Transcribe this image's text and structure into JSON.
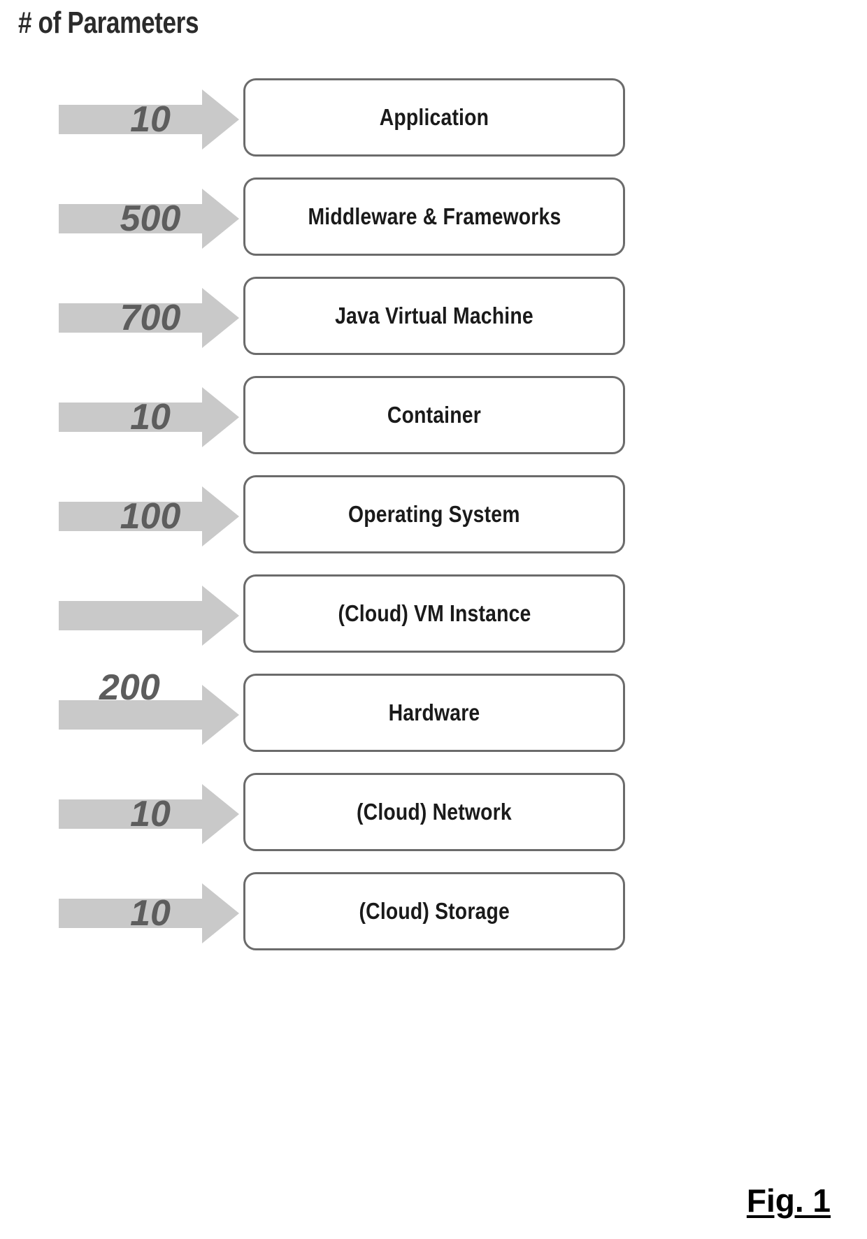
{
  "figure": {
    "title": "# of Parameters",
    "caption": "Fig. 1",
    "arrow_color": "#c9c9c9",
    "box_border_color": "#6b6b6b",
    "number_color": "#5d5d5d",
    "label_color": "#1a1a1a"
  },
  "layers": [
    {
      "parameters": "10",
      "label": "Application",
      "number_position": "on-arrow"
    },
    {
      "parameters": "500",
      "label": "Middleware & Frameworks",
      "number_position": "on-arrow"
    },
    {
      "parameters": "700",
      "label": "Java Virtual Machine",
      "number_position": "on-arrow"
    },
    {
      "parameters": "10",
      "label": "Container",
      "number_position": "on-arrow"
    },
    {
      "parameters": "100",
      "label": "Operating System",
      "number_position": "on-arrow"
    },
    {
      "parameters": "200",
      "label": "(Cloud) VM Instance",
      "number_position": "below-arrow"
    },
    {
      "parameters": "",
      "label": "Hardware",
      "number_position": "none"
    },
    {
      "parameters": "10",
      "label": "(Cloud) Network",
      "number_position": "on-arrow"
    },
    {
      "parameters": "10",
      "label": "(Cloud) Storage",
      "number_position": "on-arrow"
    }
  ]
}
